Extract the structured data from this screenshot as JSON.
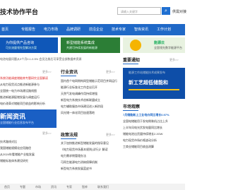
{
  "header": {
    "brand": "技术协作平台",
    "search_placeholder": "请输入关键字",
    "search_button": "搜索",
    "tel": "供需对接"
  },
  "nav": {
    "items": [
      "首页",
      "专题报告",
      "电力市场",
      "品牌调研",
      "前沿企业",
      "技术专家",
      "智库资讯",
      "工作计划"
    ]
  },
  "banners": [
    {
      "title": "为你提供产品咨询",
      "sub": "可交流量领先型解决方案"
    },
    {
      "title": "新型储能系统集成",
      "sub": "共建可持续发展的新能源"
    },
    {
      "title": "能源云",
      "sub": "全国领先数字能源平台"
    }
  ],
  "notice": "电池电量问题从3个月0.1-0.5% 会员注册后可享受全部数据库资源",
  "left_col": {
    "top_list": [
      "系统功能调度储能商专题研究全面解读",
      "从电力现货试点推进新能源参与",
      "全国统一电力市场建设路线图",
      "推进新能源配储发展与调度运行",
      "电价改革对储能项目收益的影响分析"
    ],
    "promo_title": "新闻资讯",
    "promo_sub": "全国储能行业信息发布平台",
    "bottom_list": [
      "技术路线对比",
      "我国储能规模化应用路径",
      "从2024年看储能产业链发展",
      "储能标准体系建设研究"
    ],
    "more": "更多>>"
  },
  "industry": {
    "title": "行业资讯",
    "more": "更多>>",
    "items": [
      "国内首个电网侧构网型储能示范项目并网运行",
      "能源行业标准化工作会议召开",
      "天然气发电调峰作用持续增强",
      "新型电力系统技术创新联盟成立",
      "电力辅助服务市场建设进入新阶段",
      "风光储一体化项目加速落地"
    ]
  },
  "policy": {
    "title": "政策法规",
    "more": "更多>>",
    "items": [
      "关于加快推进新型储能发展的指导意见",
      "《电力现货市场基本规则(试行)》解读",
      "电力需求侧管理办法",
      "可再生能源电力消纳保障机制",
      "新型电力系统发展蓝皮书"
    ]
  },
  "right": {
    "announce_title": "重要通知",
    "announce_more": "更多>>",
    "panel_sub": "能源工作站储能技术成果发布",
    "panel_big": "新工艺超低储能和",
    "market_title": "市场观察",
    "market_highlight": "7月储能新上工业电价同比增长0.97%",
    "market_items": [
      "全国电储能用于发电侧装机占比上升",
      "上半年风电光伏发电量同比增长",
      "储能电池出货量持续增长2.2GW",
      "电力现货市场价格波动分析",
      "工商业储能项目收益测算"
    ]
  },
  "footer": {
    "links": [
      "首页",
      "专题",
      "市场",
      "资讯",
      "专家",
      "智库",
      "联系我们"
    ]
  }
}
